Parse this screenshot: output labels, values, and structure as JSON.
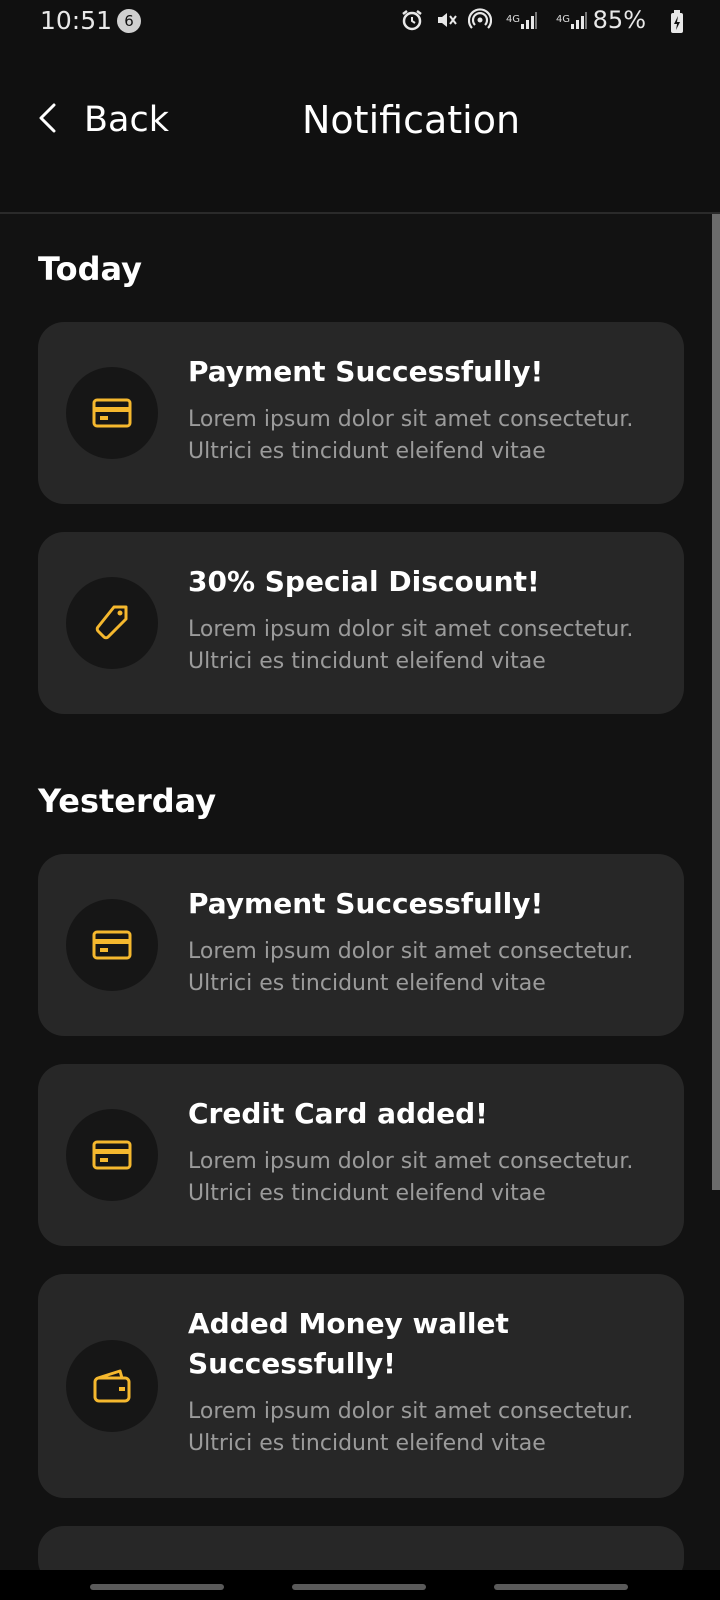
{
  "status": {
    "time": "10:51",
    "notification_count": "6",
    "network_1": "4G",
    "network_2": "4G",
    "battery": "85%"
  },
  "header": {
    "back_label": "Back",
    "title": "Notification"
  },
  "sections": [
    {
      "title": "Today",
      "items": [
        {
          "icon": "credit-card-icon",
          "title": "Payment Successfully!",
          "text": "Lorem ipsum dolor sit amet consectetur. Ultrici es tincidunt eleifend vitae"
        },
        {
          "icon": "tag-icon",
          "title": "30% Special Discount!",
          "text": "Lorem ipsum dolor sit amet consectetur. Ultrici es tincidunt eleifend vitae"
        }
      ]
    },
    {
      "title": "Yesterday",
      "items": [
        {
          "icon": "credit-card-icon",
          "title": "Payment Successfully!",
          "text": "Lorem ipsum dolor sit amet consectetur. Ultrici es tincidunt eleifend vitae"
        },
        {
          "icon": "credit-card-icon",
          "title": "Credit Card added!",
          "text": "Lorem ipsum dolor sit amet consectetur. Ultrici es tincidunt eleifend vitae"
        },
        {
          "icon": "wallet-icon",
          "title": "Added Money wallet Successfully!",
          "text": "Lorem ipsum dolor sit amet consectetur. Ultrici es tincidunt eleifend vitae"
        }
      ]
    }
  ],
  "colors": {
    "background": "#121212",
    "card": "#272727",
    "accent": "#F5B82E",
    "muted_text": "#9B9B9B"
  }
}
